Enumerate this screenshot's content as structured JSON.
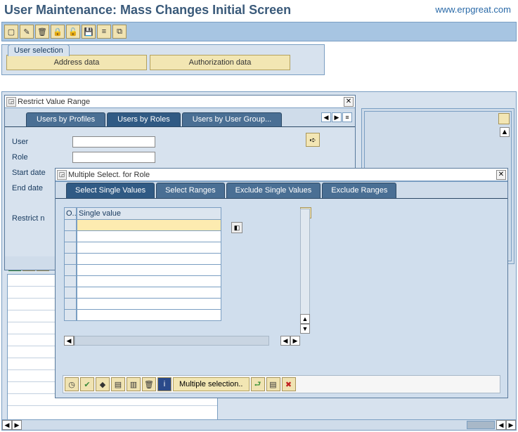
{
  "page_title": "User Maintenance: Mass Changes Initial Screen",
  "watermark": "www.erpgreat.com",
  "toolbar_icons": [
    "new",
    "edit",
    "delete",
    "lock",
    "unlock",
    "save",
    "list",
    "form"
  ],
  "user_selection": {
    "legend": "User selection",
    "btn_address": "Address data",
    "btn_auth": "Authorization data"
  },
  "dlg_restrict": {
    "title": "Restrict Value Range",
    "tabs": [
      "Users by Profiles",
      "Users by Roles",
      "Users by User Group..."
    ],
    "active_tab": 1,
    "fields": {
      "user": "User",
      "role": "Role",
      "start": "Start date",
      "end": "End date",
      "restrict": "Restrict n"
    }
  },
  "dlg_multi": {
    "title": "Multiple Select. for Role",
    "tabs": [
      "Select Single Values",
      "Select Ranges",
      "Exclude Single Values",
      "Exclude Ranges"
    ],
    "active_tab": 0,
    "col_o": "O..",
    "col_single": "Single value",
    "multi_btn": "Multiple selection.."
  }
}
